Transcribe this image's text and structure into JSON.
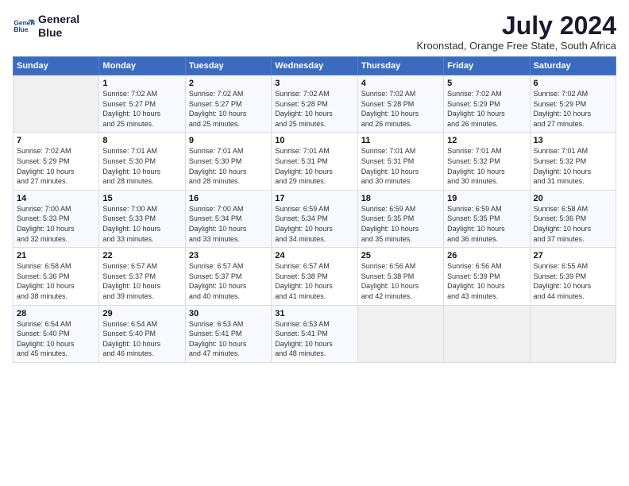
{
  "logo": {
    "line1": "General",
    "line2": "Blue"
  },
  "title": "July 2024",
  "location": "Kroonstad, Orange Free State, South Africa",
  "weekdays": [
    "Sunday",
    "Monday",
    "Tuesday",
    "Wednesday",
    "Thursday",
    "Friday",
    "Saturday"
  ],
  "weeks": [
    [
      {
        "day": "",
        "info": ""
      },
      {
        "day": "1",
        "info": "Sunrise: 7:02 AM\nSunset: 5:27 PM\nDaylight: 10 hours\nand 25 minutes."
      },
      {
        "day": "2",
        "info": "Sunrise: 7:02 AM\nSunset: 5:27 PM\nDaylight: 10 hours\nand 25 minutes."
      },
      {
        "day": "3",
        "info": "Sunrise: 7:02 AM\nSunset: 5:28 PM\nDaylight: 10 hours\nand 25 minutes."
      },
      {
        "day": "4",
        "info": "Sunrise: 7:02 AM\nSunset: 5:28 PM\nDaylight: 10 hours\nand 26 minutes."
      },
      {
        "day": "5",
        "info": "Sunrise: 7:02 AM\nSunset: 5:29 PM\nDaylight: 10 hours\nand 26 minutes."
      },
      {
        "day": "6",
        "info": "Sunrise: 7:02 AM\nSunset: 5:29 PM\nDaylight: 10 hours\nand 27 minutes."
      }
    ],
    [
      {
        "day": "7",
        "info": "Sunrise: 7:02 AM\nSunset: 5:29 PM\nDaylight: 10 hours\nand 27 minutes."
      },
      {
        "day": "8",
        "info": "Sunrise: 7:01 AM\nSunset: 5:30 PM\nDaylight: 10 hours\nand 28 minutes."
      },
      {
        "day": "9",
        "info": "Sunrise: 7:01 AM\nSunset: 5:30 PM\nDaylight: 10 hours\nand 28 minutes."
      },
      {
        "day": "10",
        "info": "Sunrise: 7:01 AM\nSunset: 5:31 PM\nDaylight: 10 hours\nand 29 minutes."
      },
      {
        "day": "11",
        "info": "Sunrise: 7:01 AM\nSunset: 5:31 PM\nDaylight: 10 hours\nand 30 minutes."
      },
      {
        "day": "12",
        "info": "Sunrise: 7:01 AM\nSunset: 5:32 PM\nDaylight: 10 hours\nand 30 minutes."
      },
      {
        "day": "13",
        "info": "Sunrise: 7:01 AM\nSunset: 5:32 PM\nDaylight: 10 hours\nand 31 minutes."
      }
    ],
    [
      {
        "day": "14",
        "info": "Sunrise: 7:00 AM\nSunset: 5:33 PM\nDaylight: 10 hours\nand 32 minutes."
      },
      {
        "day": "15",
        "info": "Sunrise: 7:00 AM\nSunset: 5:33 PM\nDaylight: 10 hours\nand 33 minutes."
      },
      {
        "day": "16",
        "info": "Sunrise: 7:00 AM\nSunset: 5:34 PM\nDaylight: 10 hours\nand 33 minutes."
      },
      {
        "day": "17",
        "info": "Sunrise: 6:59 AM\nSunset: 5:34 PM\nDaylight: 10 hours\nand 34 minutes."
      },
      {
        "day": "18",
        "info": "Sunrise: 6:59 AM\nSunset: 5:35 PM\nDaylight: 10 hours\nand 35 minutes."
      },
      {
        "day": "19",
        "info": "Sunrise: 6:59 AM\nSunset: 5:35 PM\nDaylight: 10 hours\nand 36 minutes."
      },
      {
        "day": "20",
        "info": "Sunrise: 6:58 AM\nSunset: 5:36 PM\nDaylight: 10 hours\nand 37 minutes."
      }
    ],
    [
      {
        "day": "21",
        "info": "Sunrise: 6:58 AM\nSunset: 5:36 PM\nDaylight: 10 hours\nand 38 minutes."
      },
      {
        "day": "22",
        "info": "Sunrise: 6:57 AM\nSunset: 5:37 PM\nDaylight: 10 hours\nand 39 minutes."
      },
      {
        "day": "23",
        "info": "Sunrise: 6:57 AM\nSunset: 5:37 PM\nDaylight: 10 hours\nand 40 minutes."
      },
      {
        "day": "24",
        "info": "Sunrise: 6:57 AM\nSunset: 5:38 PM\nDaylight: 10 hours\nand 41 minutes."
      },
      {
        "day": "25",
        "info": "Sunrise: 6:56 AM\nSunset: 5:38 PM\nDaylight: 10 hours\nand 42 minutes."
      },
      {
        "day": "26",
        "info": "Sunrise: 6:56 AM\nSunset: 5:39 PM\nDaylight: 10 hours\nand 43 minutes."
      },
      {
        "day": "27",
        "info": "Sunrise: 6:55 AM\nSunset: 5:39 PM\nDaylight: 10 hours\nand 44 minutes."
      }
    ],
    [
      {
        "day": "28",
        "info": "Sunrise: 6:54 AM\nSunset: 5:40 PM\nDaylight: 10 hours\nand 45 minutes."
      },
      {
        "day": "29",
        "info": "Sunrise: 6:54 AM\nSunset: 5:40 PM\nDaylight: 10 hours\nand 46 minutes."
      },
      {
        "day": "30",
        "info": "Sunrise: 6:53 AM\nSunset: 5:41 PM\nDaylight: 10 hours\nand 47 minutes."
      },
      {
        "day": "31",
        "info": "Sunrise: 6:53 AM\nSunset: 5:41 PM\nDaylight: 10 hours\nand 48 minutes."
      },
      {
        "day": "",
        "info": ""
      },
      {
        "day": "",
        "info": ""
      },
      {
        "day": "",
        "info": ""
      }
    ]
  ]
}
